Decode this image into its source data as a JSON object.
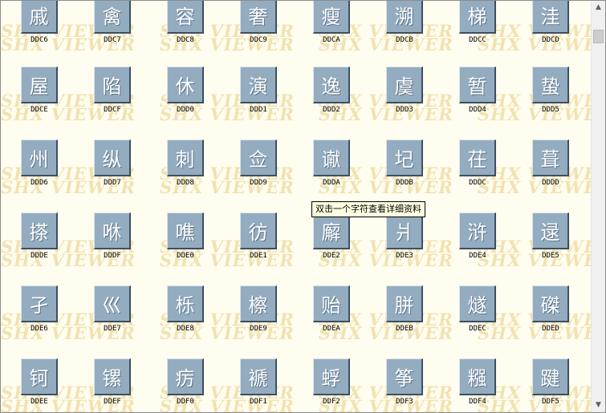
{
  "watermark_text": "SHX VIEWER",
  "tooltip": "双击一个字符查看详细资料",
  "scrollbar": {
    "up_glyph": "▲",
    "down_glyph": "▼"
  },
  "rows": [
    [
      {
        "glyph": "戚",
        "code": "DDC6"
      },
      {
        "glyph": "禽",
        "code": "DDC7"
      },
      {
        "glyph": "容",
        "code": "DDC8"
      },
      {
        "glyph": "奢",
        "code": "DDC9"
      },
      {
        "glyph": "瘦",
        "code": "DDCA"
      },
      {
        "glyph": "溯",
        "code": "DDCB"
      },
      {
        "glyph": "梯",
        "code": "DDCC"
      },
      {
        "glyph": "洼",
        "code": "DDCD"
      }
    ],
    [
      {
        "glyph": "屋",
        "code": "DDCE"
      },
      {
        "glyph": "陷",
        "code": "DDCF"
      },
      {
        "glyph": "休",
        "code": "DDD0"
      },
      {
        "glyph": "演",
        "code": "DDD1"
      },
      {
        "glyph": "逸",
        "code": "DDD2"
      },
      {
        "glyph": "虞",
        "code": "DDD3"
      },
      {
        "glyph": "暂",
        "code": "DDD4"
      },
      {
        "glyph": "蛰",
        "code": "DDD5"
      }
    ],
    [
      {
        "glyph": "州",
        "code": "DDD6"
      },
      {
        "glyph": "纵",
        "code": "DDD7"
      },
      {
        "glyph": "刺",
        "code": "DDD8"
      },
      {
        "glyph": "佥",
        "code": "DDD9"
      },
      {
        "glyph": "谳",
        "code": "DDDA"
      },
      {
        "glyph": "圮",
        "code": "DDDB"
      },
      {
        "glyph": "茌",
        "code": "DDDC"
      },
      {
        "glyph": "葺",
        "code": "DDDD"
      }
    ],
    [
      {
        "glyph": "搽",
        "code": "DDDE"
      },
      {
        "glyph": "咻",
        "code": "DDDF"
      },
      {
        "glyph": "噍",
        "code": "DDE0"
      },
      {
        "glyph": "彷",
        "code": "DDE1"
      },
      {
        "glyph": "廨",
        "code": "DDE2"
      },
      {
        "glyph": "爿",
        "code": "DDE3"
      },
      {
        "glyph": "浒",
        "code": "DDE4"
      },
      {
        "glyph": "逯",
        "code": "DDE5"
      }
    ],
    [
      {
        "glyph": "孑",
        "code": "DDE6"
      },
      {
        "glyph": "巛",
        "code": "DDE7"
      },
      {
        "glyph": "栎",
        "code": "DDE8"
      },
      {
        "glyph": "檫",
        "code": "DDE9"
      },
      {
        "glyph": "贻",
        "code": "DDEA"
      },
      {
        "glyph": "胼",
        "code": "DDEB"
      },
      {
        "glyph": "燧",
        "code": "DDEC"
      },
      {
        "glyph": "磔",
        "code": "DDED"
      }
    ],
    [
      {
        "glyph": "钶",
        "code": "DDEE"
      },
      {
        "glyph": "镙",
        "code": "DDEF"
      },
      {
        "glyph": "疠",
        "code": "DDF0"
      },
      {
        "glyph": "褫",
        "code": "DDF1"
      },
      {
        "glyph": "蜉",
        "code": "DDF2"
      },
      {
        "glyph": "筝",
        "code": "DDF3"
      },
      {
        "glyph": "糨",
        "code": "DDF4"
      },
      {
        "glyph": "踺",
        "code": "DDF5"
      }
    ]
  ]
}
